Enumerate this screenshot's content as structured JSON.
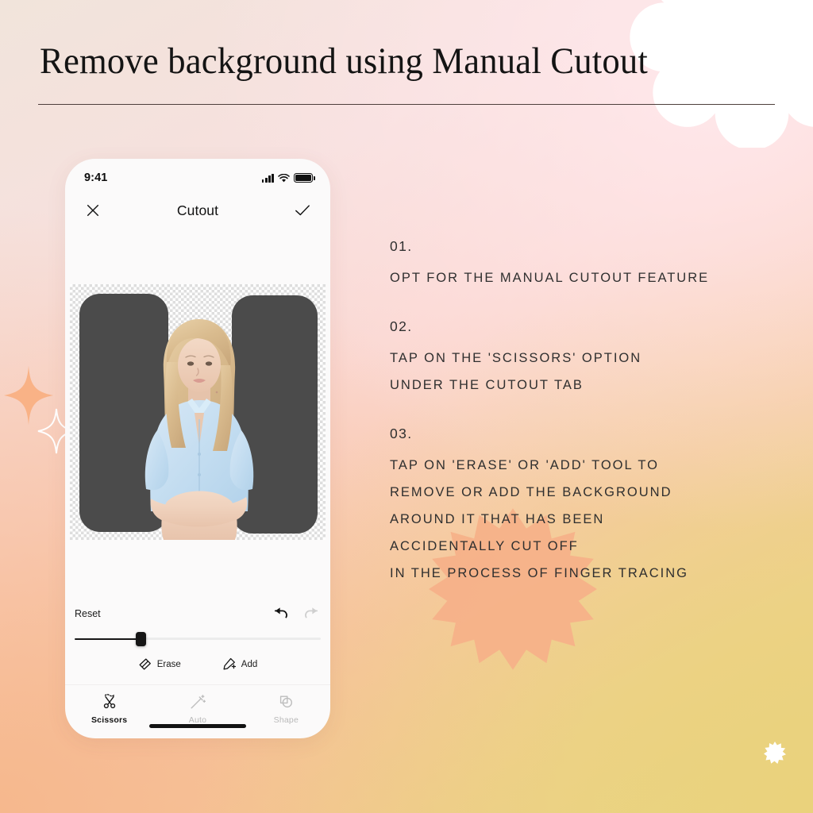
{
  "page": {
    "title": "Remove background using Manual Cutout",
    "background_colors": {
      "cream": "#f1e4db",
      "pink": "#fbd8d2",
      "peach": "#f9c9ac",
      "yellow": "#e8d785",
      "accent_burst": "#f7b189",
      "sparkle_orange": "#f9b98e"
    }
  },
  "decorations": {
    "cloud_burst": "scalloped-burst-shape",
    "sun_burst": "sun-burst-shape",
    "white_dot": "starburst-dot",
    "sparkle_filled": "sparkle-icon",
    "sparkle_outline": "sparkle-icon"
  },
  "phone": {
    "status_bar": {
      "time": "9:41",
      "signal_icon": "cellular-signal-icon",
      "wifi_icon": "wifi-icon",
      "battery_icon": "battery-full-icon"
    },
    "nav": {
      "close_icon": "close-icon",
      "title": "Cutout",
      "confirm_icon": "checkmark-icon"
    },
    "canvas": {
      "transparency_pattern": "checkerboard",
      "mask_color": "#4b4b4b",
      "subject": "woman-seated-photo"
    },
    "controls": {
      "reset_label": "Reset",
      "undo_icon": "undo-arrow-icon",
      "redo_icon": "redo-arrow-icon",
      "undo_enabled": true,
      "redo_enabled": false,
      "slider": {
        "value_percent": 27,
        "track_color": "#ececec",
        "fill_color": "#1a1a1a"
      },
      "tools": [
        {
          "label": "Erase",
          "icon": "eraser-icon"
        },
        {
          "label": "Add",
          "icon": "pencil-plus-icon"
        }
      ]
    },
    "tabs": [
      {
        "label": "Scissors",
        "icon": "scissors-icon",
        "active": true
      },
      {
        "label": "Auto",
        "icon": "magic-wand-icon",
        "active": false
      },
      {
        "label": "Shape",
        "icon": "shapes-icon",
        "active": false
      }
    ],
    "home_indicator": "home-indicator-bar"
  },
  "instructions": [
    {
      "number": "01.",
      "lines": [
        "OPT FOR THE MANUAL CUTOUT FEATURE"
      ]
    },
    {
      "number": "02.",
      "lines": [
        "TAP ON THE 'SCISSORS' OPTION",
        "UNDER THE CUTOUT TAB"
      ]
    },
    {
      "number": "03.",
      "lines": [
        "TAP ON 'ERASE' OR 'ADD' TOOL TO",
        "REMOVE OR ADD THE BACKGROUND",
        "AROUND IT THAT HAS BEEN",
        "ACCIDENTALLY CUT OFF",
        "IN THE PROCESS OF FINGER TRACING"
      ]
    }
  ]
}
